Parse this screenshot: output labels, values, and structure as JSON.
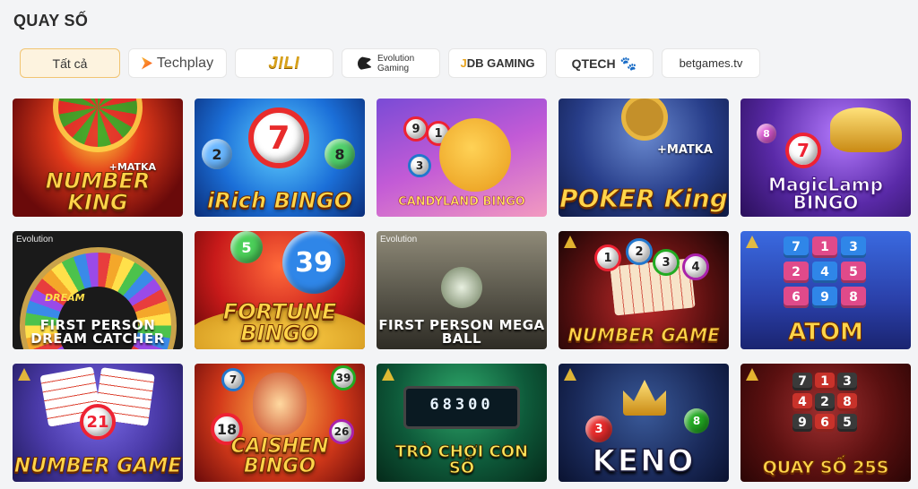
{
  "section": {
    "title": "QUAY SỐ"
  },
  "filters": [
    {
      "label": "Tất cả",
      "active": true
    },
    {
      "label": "Techplay"
    },
    {
      "label": "JILI"
    },
    {
      "label": "Evolution Gaming"
    },
    {
      "label": "JDB GAMING"
    },
    {
      "label": "QTECH"
    },
    {
      "label": "betgames.tv"
    }
  ],
  "games": [
    {
      "title": "NUMBER KING",
      "subtitle": "+MATKA"
    },
    {
      "title": "iRich BINGO"
    },
    {
      "title": "CANDYLAND BINGO"
    },
    {
      "title": "POKER King",
      "subtitle": "+MATKA"
    },
    {
      "title": "MagicLamp BINGO"
    },
    {
      "title": "FIRST PERSON DREAM CATCHER",
      "provider": "Evolution",
      "badge": "DREAM"
    },
    {
      "title": "FORTUNE BINGO",
      "ball": "39"
    },
    {
      "title": "FIRST PERSON MEGA BALL",
      "provider": "Evolution"
    },
    {
      "title": "NUMBER GAME"
    },
    {
      "title": "ATOM",
      "tiles": [
        "7",
        "1",
        "3",
        "2",
        "4",
        "5",
        "6",
        "9",
        "8"
      ]
    },
    {
      "title": "NUMBER GAME"
    },
    {
      "title": "CAISHEN BINGO"
    },
    {
      "title": "TRÒ CHƠI CON SỐ",
      "display": "68300"
    },
    {
      "title": "KENO"
    },
    {
      "title": "QUAY SỐ 25S",
      "tiles": [
        "7",
        "1",
        "3",
        "4",
        "2",
        "8",
        "9",
        "6",
        "5"
      ]
    }
  ]
}
